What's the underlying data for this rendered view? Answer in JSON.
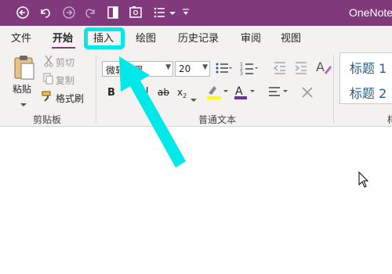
{
  "app": {
    "title": "OneNote"
  },
  "colors": {
    "title_bar": "#80397b",
    "ribbon": "#f3f2f1",
    "highlight": "#00e8e8",
    "arrow": "#00e8e8",
    "style_blue": "#2e5c8a"
  },
  "quick_access": {
    "icons": [
      "back-icon",
      "undo-icon",
      "forward-icon",
      "redo-icon",
      "dock-icon",
      "screen-clip-icon",
      "list-icon",
      "customize-icon"
    ]
  },
  "tabs": [
    {
      "label": "文件"
    },
    {
      "label": "开始"
    },
    {
      "label": "插入"
    },
    {
      "label": "绘图"
    },
    {
      "label": "历史记录"
    },
    {
      "label": "审阅"
    },
    {
      "label": "视图"
    }
  ],
  "active_tab": "开始",
  "highlighted_tab": "插入",
  "clipboard": {
    "paste": "粘贴",
    "cut": "剪切",
    "copy": "复制",
    "format_painter": "格式刷",
    "group_label": "剪贴板"
  },
  "font": {
    "name": "微软雅黑",
    "size": "20",
    "bold": "B",
    "underline": "U",
    "strike": "ab",
    "subscript": "x",
    "sub_mark": "2",
    "group_label": "普通文本"
  },
  "styles": {
    "heading1": "标题 1",
    "heading2": "标题 2",
    "group_label_partial": "样"
  }
}
